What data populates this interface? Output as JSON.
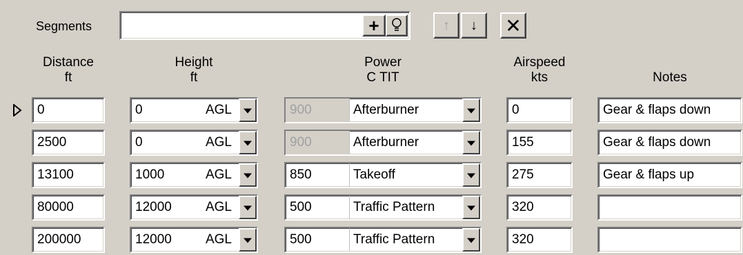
{
  "segments": {
    "label": "Segments",
    "value": ""
  },
  "toolbar": {
    "add_symbol": "+",
    "hint_symbol": "lightbulb-icon",
    "move_up_symbol": "↑",
    "move_down_symbol": "↓",
    "delete_symbol": "✕"
  },
  "headers": {
    "distance": "Distance",
    "distance_unit": "ft",
    "height": "Height",
    "height_unit": "ft",
    "power": "Power",
    "power_unit": "C TIT",
    "airspeed": "Airspeed",
    "airspeed_unit": "kts",
    "notes": "Notes"
  },
  "rows": [
    {
      "current": true,
      "distance": "0",
      "height": "0",
      "height_ref": "AGL",
      "tit": "900",
      "tit_disabled": true,
      "power": "Afterburner",
      "airspeed": "0",
      "notes": "Gear & flaps down"
    },
    {
      "current": false,
      "distance": "2500",
      "height": "0",
      "height_ref": "AGL",
      "tit": "900",
      "tit_disabled": true,
      "power": "Afterburner",
      "airspeed": "155",
      "notes": "Gear & flaps down"
    },
    {
      "current": false,
      "distance": "13100",
      "height": "1000",
      "height_ref": "AGL",
      "tit": "850",
      "tit_disabled": false,
      "power": "Takeoff",
      "airspeed": "275",
      "notes": "Gear & flaps up"
    },
    {
      "current": false,
      "distance": "80000",
      "height": "12000",
      "height_ref": "AGL",
      "tit": "500",
      "tit_disabled": false,
      "power": "Traffic Pattern",
      "airspeed": "320",
      "notes": ""
    },
    {
      "current": false,
      "distance": "200000",
      "height": "12000",
      "height_ref": "AGL",
      "tit": "500",
      "tit_disabled": false,
      "power": "Traffic Pattern",
      "airspeed": "320",
      "notes": ""
    }
  ]
}
